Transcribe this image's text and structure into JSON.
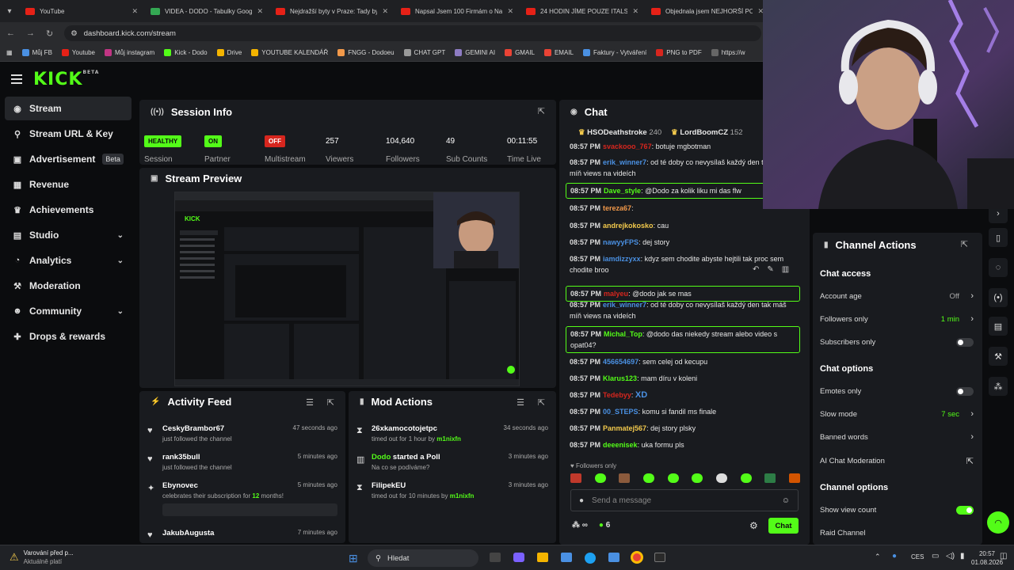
{
  "browser": {
    "tabs": [
      {
        "title": "YouTube"
      },
      {
        "title": "VIDEA - DODO - Tabulky Googl"
      },
      {
        "title": "Nejdražší byty v Praze: Tady by"
      },
      {
        "title": "Napsal Jsem 100 Firmám o Na"
      },
      {
        "title": "24 HODIN JÍME POUZE ITALSK"
      },
      {
        "title": "Objednala jsem NEJHORŠÍ POJ"
      }
    ],
    "url": "dashboard.kick.com/stream",
    "bookmarks": [
      "Můj FB",
      "Youtube",
      "Můj instagram",
      "Kick - Dodo",
      "Drive",
      "YOUTUBE KALENDÁŘ",
      "FNGG - Dodoeu",
      "CHAT GPT",
      "GEMINI AI",
      "GMAIL",
      "EMAIL",
      "Faktury - Vytváření",
      "PNG to PDF",
      "https://w"
    ]
  },
  "kick": {
    "logo": "KICK",
    "logo_sup": "BETA"
  },
  "sidebar": {
    "items": [
      {
        "label": "Stream",
        "icon": "broadcast-icon"
      },
      {
        "label": "Stream URL & Key",
        "icon": "link-icon"
      },
      {
        "label": "Advertisement",
        "icon": "ad-icon",
        "badge": "Beta"
      },
      {
        "label": "Revenue",
        "icon": "revenue-icon"
      },
      {
        "label": "Achievements",
        "icon": "trophy-icon"
      },
      {
        "label": "Studio",
        "icon": "studio-icon"
      },
      {
        "label": "Analytics",
        "icon": "analytics-icon"
      },
      {
        "label": "Moderation",
        "icon": "moderation-icon"
      },
      {
        "label": "Community",
        "icon": "community-icon"
      },
      {
        "label": "Drops & rewards",
        "icon": "gift-icon"
      }
    ]
  },
  "session": {
    "title": "Session Info",
    "session_status": "HEALTHY",
    "session_label": "Session",
    "partner_status": "ON",
    "partner_label": "Partner",
    "multistream_status": "OFF",
    "multistream_label": "Multistream",
    "viewers": "257",
    "viewers_label": "Viewers",
    "followers": "104,640",
    "followers_label": "Followers",
    "subs": "49",
    "subs_label": "Sub Counts",
    "time": "00:11:55",
    "time_label": "Time Live"
  },
  "preview": {
    "title": "Stream Preview"
  },
  "activity": {
    "title": "Activity Feed",
    "items": [
      {
        "name": "CeskyBrambor67",
        "sub": "just followed the channel",
        "time": "47 seconds ago"
      },
      {
        "name": "rank35bull",
        "sub": "just followed the channel",
        "time": "5 minutes ago"
      },
      {
        "name": "Ebynovec",
        "sub_pre": "celebrates their subscription for ",
        "sub_num": "12",
        "sub_post": " months!",
        "time": "5 minutes ago"
      },
      {
        "name": "JakubAugusta",
        "time": "7 minutes ago"
      }
    ]
  },
  "mod": {
    "title": "Mod Actions",
    "items": [
      {
        "name": "26xkamocotojetpc",
        "sub_pre": "timed out for 1 hour by ",
        "sub_by": "m1nixfn",
        "time": "34 seconds ago"
      },
      {
        "name_pre": "Dodo",
        "name_post": " started a Poll",
        "sub": "Na co se podíváme?",
        "time": "3 minutes ago"
      },
      {
        "name": "FilipekEU",
        "sub_pre": "timed out for 10 minutes by ",
        "sub_by": "m1nixfn",
        "time": "3 minutes ago"
      }
    ]
  },
  "chat": {
    "title": "Chat",
    "top": [
      {
        "name": "HSODeathstroke",
        "n": "240"
      },
      {
        "name": "LordBoomCZ",
        "n": "152"
      }
    ],
    "messages": [
      {
        "ts": "08:57 PM",
        "user": "svackooo_767",
        "color": "#d7261e",
        "text": "botuje mgbotman"
      },
      {
        "ts": "08:57 PM",
        "user": "erik_winner7",
        "color": "#4a90e2",
        "text": "od té doby co nevysílaš každý den tak máš míň views na videích"
      },
      {
        "ts": "08:57 PM",
        "user": "Dave_style",
        "color": "#53fc18",
        "text": "@Dodo za kolik liku mi das flw",
        "hl": true
      },
      {
        "ts": "08:57 PM",
        "user": "tereza67",
        "color": "#f2994a",
        "text": ""
      },
      {
        "ts": "08:57 PM",
        "user": "andrejkokosko",
        "color": "#f2c94c",
        "text": "cau"
      },
      {
        "ts": "08:57 PM",
        "user": "nawyyFPS",
        "color": "#4a90e2",
        "text": "dej story"
      },
      {
        "ts": "08:57 PM",
        "user": "iamdizzyxx",
        "color": "#4a90e2",
        "text": "kdyz sem chodite abyste hejtili tak proc sem chodite broo"
      },
      {
        "ts": "08:57 PM",
        "user": "malyeu",
        "color": "#d7261e",
        "text": "@dodo jak se mas",
        "hl": true
      },
      {
        "ts": "08:57 PM",
        "user": "erik_winner7",
        "color": "#4a90e2",
        "text": "od té doby co nevysílaš každý den tak máš míň views na videích"
      },
      {
        "ts": "08:57 PM",
        "user": "Michal_Top",
        "color": "#53fc18",
        "text": "@dodo das niekedy stream alebo video s opat04?",
        "hl": true
      },
      {
        "ts": "08:57 PM",
        "user": "456654697",
        "color": "#4a90e2",
        "text": "sem celej od kecupu"
      },
      {
        "ts": "08:57 PM",
        "user": "Klarus123",
        "color": "#53fc18",
        "text": "mam díru v koleni"
      },
      {
        "ts": "08:57 PM",
        "user": "Tedebyy",
        "color": "#d7261e",
        "text": "XD"
      },
      {
        "ts": "08:57 PM",
        "user": "00_STEPS",
        "color": "#4a90e2",
        "text": "komu si fandil ms finale"
      },
      {
        "ts": "08:57 PM",
        "user": "Panmatej567",
        "color": "#f2c94c",
        "text": "dej story plsky"
      },
      {
        "ts": "08:57 PM",
        "user": "deeenisek",
        "color": "#53fc18",
        "text": "uka formu pls"
      }
    ],
    "followers_only": "Followers only",
    "placeholder": "Send a message",
    "viewer_count": "6",
    "send_label": "Chat"
  },
  "channel_actions": {
    "title": "Channel Actions",
    "chat_access": "Chat access",
    "account_age": "Account age",
    "account_age_val": "Off",
    "followers_only": "Followers only",
    "followers_only_val": "1 min",
    "subscribers_only": "Subscribers only",
    "chat_options": "Chat options",
    "emotes_only": "Emotes only",
    "slow_mode": "Slow mode",
    "slow_mode_val": "7 sec",
    "banned_words": "Banned words",
    "ai_moderation": "AI Chat Moderation",
    "channel_options": "Channel options",
    "show_view_count": "Show view count",
    "raid_channel": "Raid Channel"
  },
  "taskbar": {
    "weather_title": "Varování před p...",
    "weather_sub": "Aktuálně platí",
    "search": "Hledat",
    "lang": "CES",
    "time": "20:57",
    "date": "01.08.2026"
  },
  "colors": {
    "accent": "#53fc18",
    "panel": "#191b1f",
    "bg": "#0b0c0e",
    "danger": "#d7261e"
  }
}
